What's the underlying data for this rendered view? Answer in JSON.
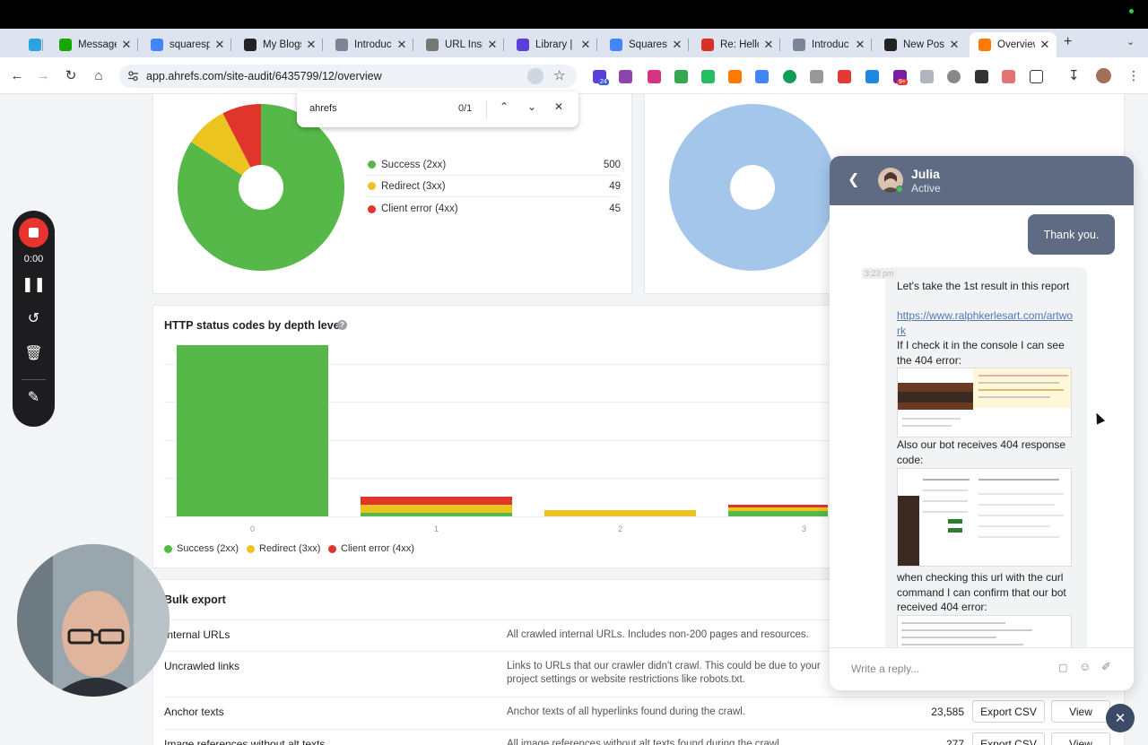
{
  "browser": {
    "tabs": [
      {
        "label": "",
        "icon": "telegram-icon",
        "color": "#2aa3e0"
      },
      {
        "label": "Message",
        "icon": "upwork-icon",
        "color": "#14a800"
      },
      {
        "label": "squaresp",
        "icon": "google-icon",
        "color": "#4285f4"
      },
      {
        "label": "My Blogs",
        "icon": "squarespace-icon",
        "color": "#222222"
      },
      {
        "label": "Introduc",
        "icon": "doc-icon",
        "color": "#7a8597"
      },
      {
        "label": "URL Insp",
        "icon": "search-console-icon",
        "color": "#777777"
      },
      {
        "label": "Library |",
        "icon": "library-icon",
        "color": "#5b3fd9"
      },
      {
        "label": "Squares",
        "icon": "google-icon",
        "color": "#4285f4"
      },
      {
        "label": "Re: Hello",
        "icon": "gmail-icon",
        "color": "#d93025"
      },
      {
        "label": "Introduc",
        "icon": "doc-icon",
        "color": "#7a8597"
      },
      {
        "label": "New Pos",
        "icon": "squarespace-icon",
        "color": "#222222"
      },
      {
        "label": "Overview",
        "icon": "ahrefs-icon",
        "color": "#ff7a00"
      }
    ],
    "url": "app.ahrefs.com/site-audit/6435799/12/overview",
    "extension_badge_1": "24",
    "extension_badge_2": "9+"
  },
  "find_bar": {
    "query": "ahrefs",
    "count": "0/1"
  },
  "status_pie": {
    "legend": [
      {
        "label": "Success (2xx)",
        "count": "500",
        "color": "#55b848"
      },
      {
        "label": "Redirect (3xx)",
        "count": "49",
        "color": "#ebc41f"
      },
      {
        "label": "Client error (4xx)",
        "count": "45",
        "color": "#e0352b"
      }
    ]
  },
  "depth_chart": {
    "title": "HTTP status codes by depth level",
    "help": "?",
    "legend": [
      {
        "label": "Success (2xx)",
        "color": "#55b848"
      },
      {
        "label": "Redirect (3xx)",
        "color": "#ebc41f"
      },
      {
        "label": "Client error (4xx)",
        "color": "#e0352b"
      }
    ]
  },
  "chart_data": [
    {
      "type": "pie",
      "categories": [
        "Success (2xx)",
        "Redirect (3xx)",
        "Client error (4xx)"
      ],
      "values": [
        500,
        49,
        45
      ],
      "colors": [
        "#55b848",
        "#ebc41f",
        "#e0352b"
      ],
      "donut": true
    },
    {
      "type": "pie",
      "categories": [
        ""
      ],
      "values": [
        1
      ],
      "colors": [
        "#a3c6ea"
      ],
      "donut": true
    },
    {
      "type": "bar",
      "stacked": true,
      "categories": [
        "0",
        "1",
        "2",
        "3"
      ],
      "series": [
        {
          "name": "Success (2xx)",
          "values": [
            440,
            10,
            0,
            14
          ],
          "color": "#55b848"
        },
        {
          "name": "Redirect (3xx)",
          "values": [
            0,
            20,
            17,
            8
          ],
          "color": "#ebc41f"
        },
        {
          "name": "Client error (4xx)",
          "values": [
            0,
            20,
            0,
            8
          ],
          "color": "#e0352b"
        }
      ],
      "ylim": [
        0,
        560
      ],
      "grid": true,
      "legend": "bottom-left"
    }
  ],
  "bulk_export": {
    "title": "Bulk export",
    "export_label": "Export CSV",
    "view_label": "View",
    "rows": [
      {
        "name": "Internal URLs",
        "desc": "All crawled internal URLs. Includes non-200 pages and resources.",
        "count": ""
      },
      {
        "name": "Uncrawled links",
        "desc": "Links to URLs that our crawler didn't crawl. This could be due to your project settings or website restrictions like robots.txt.",
        "count": ""
      },
      {
        "name": "Anchor texts",
        "desc": "Anchor texts of all hyperlinks found during the crawl.",
        "count": "23,585"
      },
      {
        "name": "Image references without alt texts",
        "desc": "All image references without alt texts found during the crawl.",
        "count": "277"
      }
    ]
  },
  "recorder": {
    "time": "0:00"
  },
  "chat": {
    "agent_name": "Julia",
    "agent_status": "Active",
    "outgoing": "Thank you.",
    "timestamp": "3:23 pm",
    "msg1": "Let's take the 1st result in this report",
    "link": "https://www.ralphkerlesart.com/artwork",
    "msg2": "If I check it in the console I can see the 404 error:",
    "msg3": "Also our bot receives 404 response code:",
    "msg4": "when checking this url with the curl command I can confirm that our bot received 404 error:",
    "input_placeholder": "Write a reply..."
  }
}
